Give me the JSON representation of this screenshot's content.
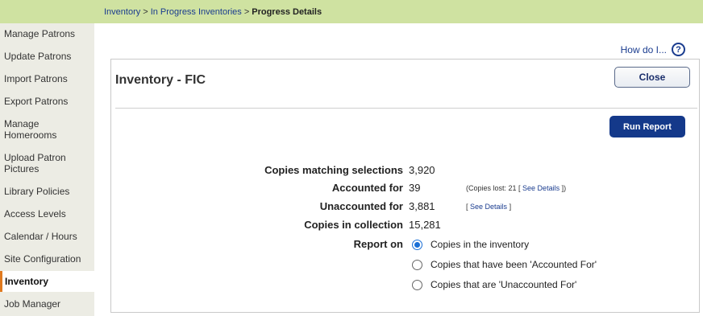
{
  "breadcrumb": {
    "items": [
      "Inventory",
      "In Progress Inventories"
    ],
    "current": "Progress Details",
    "separator": ">"
  },
  "sidebar": {
    "items": [
      {
        "label": "Manage Patrons"
      },
      {
        "label": "Update Patrons"
      },
      {
        "label": "Import Patrons"
      },
      {
        "label": "Export Patrons"
      },
      {
        "label": "Manage Homerooms"
      },
      {
        "label": "Upload Patron Pictures"
      },
      {
        "label": "Library Policies"
      },
      {
        "label": "Access Levels"
      },
      {
        "label": "Calendar / Hours"
      },
      {
        "label": "Site Configuration"
      },
      {
        "label": "Inventory"
      },
      {
        "label": "Job Manager"
      }
    ],
    "active": "Inventory"
  },
  "help": {
    "label": "How do I...",
    "icon": "question-circle-icon"
  },
  "panel": {
    "title": "Inventory - FIC",
    "close_label": "Close",
    "run_label": "Run Report"
  },
  "stats": {
    "matching_label": "Copies matching selections",
    "matching_value": "3,920",
    "accounted_label": "Accounted for",
    "accounted_value": "39",
    "accounted_note_prefix": "(Copies lost: 21 [",
    "accounted_note_link": "See Details",
    "accounted_note_suffix": "])",
    "unaccounted_label": "Unaccounted for",
    "unaccounted_value": "3,881",
    "unaccounted_note_prefix": "[",
    "unaccounted_note_link": "See Details",
    "unaccounted_note_suffix": "]",
    "collection_label": "Copies in collection",
    "collection_value": "15,281"
  },
  "report_on": {
    "label": "Report on",
    "options": [
      "Copies in the inventory",
      "Copies that have been 'Accounted For'",
      "Copies that are 'Unaccounted For'"
    ],
    "selected": "Copies in the inventory"
  },
  "colors": {
    "topbar": "#cfe2a1",
    "sidebar": "#ecece4",
    "accent": "#14398a",
    "active_marker": "#e07a1f"
  }
}
